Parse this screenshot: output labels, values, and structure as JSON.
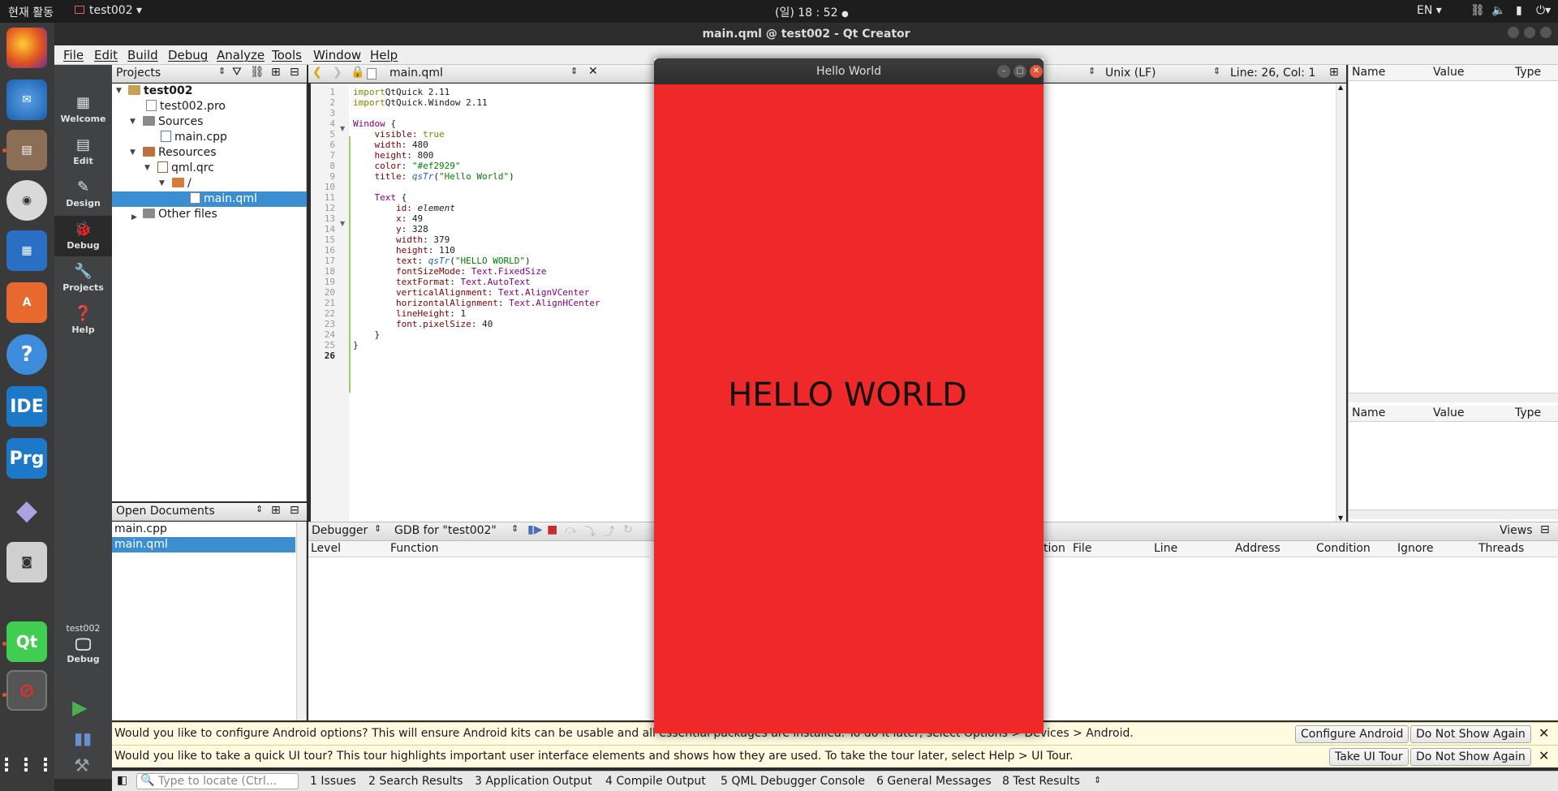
{
  "topbar": {
    "activities": "현재 활동",
    "app_name": "test002",
    "clock": "(일) 18 : 52",
    "lang": "EN"
  },
  "window_title": "main.qml @ test002 - Qt Creator",
  "menu": [
    "File",
    "Edit",
    "Build",
    "Debug",
    "Analyze",
    "Tools",
    "Window",
    "Help"
  ],
  "modes": [
    "Welcome",
    "Edit",
    "Design",
    "Debug",
    "Projects",
    "Help"
  ],
  "kit": {
    "project": "test002",
    "mode": "Debug"
  },
  "projects_panel": {
    "title": "Projects",
    "tree": [
      "test002",
      "test002.pro",
      "Sources",
      "main.cpp",
      "Resources",
      "qml.qrc",
      "/",
      "main.qml",
      "Other files"
    ]
  },
  "editor": {
    "file": "main.qml",
    "line_ending": "Unix (LF)",
    "position": "Line: 26, Col: 1"
  },
  "code_lines": [
    [
      [
        "kw",
        "import"
      ],
      [
        "",
        "QtQuick 2.11"
      ]
    ],
    [
      [
        "kw",
        "import"
      ],
      [
        "",
        "QtQuick.Window 2.11"
      ]
    ],
    [],
    [
      [
        "ty",
        "Window"
      ],
      [
        "",
        " {"
      ]
    ],
    [
      [
        "",
        "    "
      ],
      [
        "pr",
        "visible"
      ],
      [
        "",
        ": "
      ],
      [
        "kw",
        "true"
      ]
    ],
    [
      [
        "",
        "    "
      ],
      [
        "pr",
        "width"
      ],
      [
        "",
        ": 480"
      ]
    ],
    [
      [
        "",
        "    "
      ],
      [
        "pr",
        "height"
      ],
      [
        "",
        ": 800"
      ]
    ],
    [
      [
        "",
        "    "
      ],
      [
        "pr",
        "color"
      ],
      [
        "",
        ": "
      ],
      [
        "st",
        "\"#ef2929\""
      ]
    ],
    [
      [
        "",
        "    "
      ],
      [
        "pr",
        "title"
      ],
      [
        "",
        ": "
      ],
      [
        "fn",
        "qsTr"
      ],
      [
        "",
        "("
      ],
      [
        "st",
        "\"Hello World\""
      ],
      [
        "",
        ")"
      ]
    ],
    [],
    [
      [
        "",
        "    "
      ],
      [
        "ty",
        "Text"
      ],
      [
        "",
        " {"
      ]
    ],
    [
      [
        "",
        "        "
      ],
      [
        "pr",
        "id"
      ],
      [
        "",
        ": "
      ],
      [
        "it",
        "element"
      ]
    ],
    [
      [
        "",
        "        "
      ],
      [
        "pr",
        "x"
      ],
      [
        "",
        ": 49"
      ]
    ],
    [
      [
        "",
        "        "
      ],
      [
        "pr",
        "y"
      ],
      [
        "",
        ": 328"
      ]
    ],
    [
      [
        "",
        "        "
      ],
      [
        "pr",
        "width"
      ],
      [
        "",
        ": 379"
      ]
    ],
    [
      [
        "",
        "        "
      ],
      [
        "pr",
        "height"
      ],
      [
        "",
        ": 110"
      ]
    ],
    [
      [
        "",
        "        "
      ],
      [
        "pr",
        "text"
      ],
      [
        "",
        ": "
      ],
      [
        "fn",
        "qsTr"
      ],
      [
        "",
        "("
      ],
      [
        "st",
        "\"HELLO WORLD\""
      ],
      [
        "",
        ")"
      ]
    ],
    [
      [
        "",
        "        "
      ],
      [
        "pr",
        "fontSizeMode"
      ],
      [
        "",
        ": "
      ],
      [
        "ty",
        "Text"
      ],
      [
        "",
        "."
      ],
      [
        "ty",
        "FixedSize"
      ]
    ],
    [
      [
        "",
        "        "
      ],
      [
        "pr",
        "textFormat"
      ],
      [
        "",
        ": "
      ],
      [
        "ty",
        "Text"
      ],
      [
        "",
        "."
      ],
      [
        "ty",
        "AutoText"
      ]
    ],
    [
      [
        "",
        "        "
      ],
      [
        "pr",
        "verticalAlignment"
      ],
      [
        "",
        ": "
      ],
      [
        "ty",
        "Text"
      ],
      [
        "",
        "."
      ],
      [
        "ty",
        "AlignVCenter"
      ]
    ],
    [
      [
        "",
        "        "
      ],
      [
        "pr",
        "horizontalAlignment"
      ],
      [
        "",
        ": "
      ],
      [
        "ty",
        "Text"
      ],
      [
        "",
        "."
      ],
      [
        "ty",
        "AlignHCenter"
      ]
    ],
    [
      [
        "",
        "        "
      ],
      [
        "pr",
        "lineHeight"
      ],
      [
        "",
        ": 1"
      ]
    ],
    [
      [
        "",
        "        "
      ],
      [
        "pr",
        "font.pixelSize"
      ],
      [
        "",
        ": 40"
      ]
    ],
    [
      [
        "",
        "    }"
      ]
    ],
    [
      [
        "",
        "}"
      ]
    ],
    []
  ],
  "open_documents": {
    "title": "Open Documents",
    "items": [
      "main.cpp",
      "main.qml"
    ]
  },
  "locals": {
    "headers": [
      "Name",
      "Value",
      "Type"
    ]
  },
  "watchers": {
    "headers": [
      "Name",
      "Value",
      "Type"
    ]
  },
  "debugger": {
    "selector": "Debugger",
    "engine": "GDB for \"test002\"",
    "stack_headers": [
      "Level",
      "Function"
    ],
    "bp_headers_partial": "tion",
    "bp_headers": [
      "File",
      "Line",
      "Address",
      "Condition",
      "Ignore",
      "Threads"
    ],
    "views": "Views"
  },
  "info_android": {
    "message": "Would you like to configure Android options? This will ensure Android kits can be usable and all essential packages are installed. To do it later, select Options > Devices > Android.",
    "configure": "Configure Android",
    "dismiss": "Do Not Show Again"
  },
  "info_tour": {
    "message": "Would you like to take a quick UI tour? This tour highlights important user interface elements and shows how they are used. To take the tour later, select Help > UI Tour.",
    "take": "Take UI Tour",
    "dismiss": "Do Not Show Again"
  },
  "statusbar": {
    "locator_placeholder": "Type to locate (Ctrl...",
    "panes": [
      "1  Issues",
      "2  Search Results",
      "3  Application Output",
      "4  Compile Output",
      "5  QML Debugger Console",
      "6  General Messages",
      "8  Test Results"
    ]
  },
  "hello_window": {
    "title": "Hello World",
    "bg_color": "#ef2929",
    "text": "HELLO WORLD"
  },
  "dock_apps": [
    "firefox-icon",
    "thunderbird-icon",
    "files-icon",
    "rhythmbox-icon",
    "writer-icon",
    "software-icon",
    "help-icon",
    "IDE",
    "Prg",
    "diamond-icon",
    "camera-icon",
    "Qt",
    "blocked-icon"
  ]
}
